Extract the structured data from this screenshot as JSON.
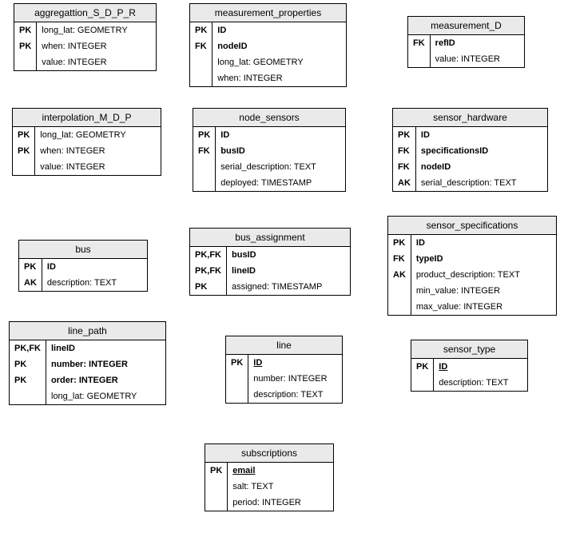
{
  "entities": {
    "aggregattion": {
      "title": "aggregattion_S_D_P_R",
      "rows": [
        {
          "key": "PK",
          "attr": "long_lat: GEOMETRY",
          "bold": false
        },
        {
          "key": "PK",
          "attr": "when: INTEGER",
          "bold": false
        },
        {
          "key": "",
          "attr": "value: INTEGER",
          "bold": false
        }
      ]
    },
    "measurement_properties": {
      "title": "measurement_properties",
      "rows": [
        {
          "key": "PK",
          "attr": "ID",
          "bold": true
        },
        {
          "key": "FK",
          "attr": "nodeID",
          "bold": true
        },
        {
          "key": "",
          "attr": "long_lat: GEOMETRY",
          "bold": false
        },
        {
          "key": "",
          "attr": "when: INTEGER",
          "bold": false
        }
      ]
    },
    "measurement_d": {
      "title": "measurement_D",
      "rows": [
        {
          "key": "FK",
          "attr": "refID",
          "bold": true
        },
        {
          "key": "",
          "attr": "value: INTEGER",
          "bold": false
        }
      ]
    },
    "interpolation": {
      "title": "interpolation_M_D_P",
      "rows": [
        {
          "key": "PK",
          "attr": "long_lat: GEOMETRY",
          "bold": false
        },
        {
          "key": "PK",
          "attr": "when: INTEGER",
          "bold": false
        },
        {
          "key": "",
          "attr": "value: INTEGER",
          "bold": false
        }
      ]
    },
    "node_sensors": {
      "title": "node_sensors",
      "rows": [
        {
          "key": "PK",
          "attr": "ID",
          "bold": true
        },
        {
          "key": "FK",
          "attr": "busID",
          "bold": true
        },
        {
          "key": "",
          "attr": "serial_description: TEXT",
          "bold": false
        },
        {
          "key": "",
          "attr": "deployed: TIMESTAMP",
          "bold": false
        }
      ]
    },
    "sensor_hardware": {
      "title": "sensor_hardware",
      "rows": [
        {
          "key": "PK",
          "attr": "ID",
          "bold": true
        },
        {
          "key": "FK",
          "attr": "specificationsID",
          "bold": true
        },
        {
          "key": "FK",
          "attr": "nodeID",
          "bold": true
        },
        {
          "key": "AK",
          "attr": "serial_description: TEXT",
          "bold": false
        }
      ]
    },
    "bus": {
      "title": "bus",
      "rows": [
        {
          "key": "PK",
          "attr": "ID",
          "bold": true
        },
        {
          "key": "AK",
          "attr": "description: TEXT",
          "bold": false
        }
      ]
    },
    "bus_assignment": {
      "title": "bus_assignment",
      "rows": [
        {
          "key": "PK,FK",
          "attr": "busID",
          "bold": true
        },
        {
          "key": "PK,FK",
          "attr": "lineID",
          "bold": true
        },
        {
          "key": "PK",
          "attr": "assigned: TIMESTAMP",
          "bold": false
        }
      ]
    },
    "sensor_specifications": {
      "title": "sensor_specifications",
      "rows": [
        {
          "key": "PK",
          "attr": "ID",
          "bold": true
        },
        {
          "key": "FK",
          "attr": "typeID",
          "bold": true
        },
        {
          "key": "AK",
          "attr": "product_description: TEXT",
          "bold": false
        },
        {
          "key": "",
          "attr": "min_value: INTEGER",
          "bold": false
        },
        {
          "key": "",
          "attr": "max_value: INTEGER",
          "bold": false
        }
      ]
    },
    "line_path": {
      "title": "line_path",
      "rows": [
        {
          "key": "PK,FK",
          "attr": "lineID",
          "bold": true
        },
        {
          "key": "PK",
          "attr": "number: INTEGER",
          "bold": true
        },
        {
          "key": "PK",
          "attr": "order: INTEGER",
          "bold": true
        },
        {
          "key": "",
          "attr": "long_lat: GEOMETRY",
          "bold": false
        }
      ]
    },
    "line": {
      "title": "line",
      "rows": [
        {
          "key": "PK",
          "attr": "ID",
          "bold": true,
          "uline": true
        },
        {
          "key": "",
          "attr": "number: INTEGER",
          "bold": false
        },
        {
          "key": "",
          "attr": "description: TEXT",
          "bold": false
        }
      ]
    },
    "sensor_type": {
      "title": "sensor_type",
      "rows": [
        {
          "key": "PK",
          "attr": "ID",
          "bold": true,
          "uline": true
        },
        {
          "key": "",
          "attr": "description: TEXT",
          "bold": false
        }
      ]
    },
    "subscriptions": {
      "title": "subscriptions",
      "rows": [
        {
          "key": "PK",
          "attr": "email",
          "bold": true,
          "uline": true
        },
        {
          "key": "",
          "attr": "salt: TEXT",
          "bold": false
        },
        {
          "key": "",
          "attr": "period: INTEGER",
          "bold": false
        }
      ]
    }
  }
}
